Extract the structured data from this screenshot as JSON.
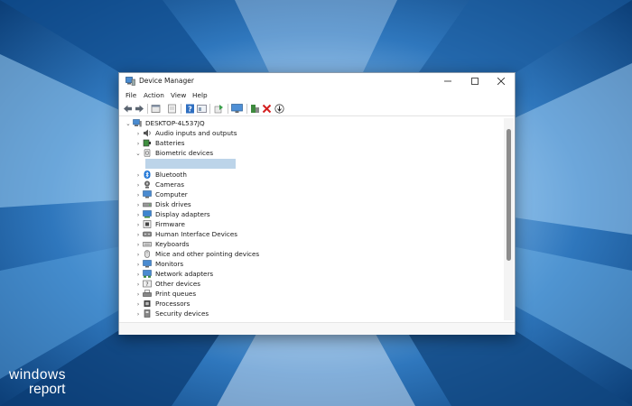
{
  "window": {
    "title": "Device Manager",
    "controls": {
      "minimize": "minimize",
      "maximize": "maximize",
      "close": "close"
    }
  },
  "menu": [
    "File",
    "Action",
    "View",
    "Help"
  ],
  "toolbar": {
    "icons": [
      "back-icon",
      "forward-icon",
      "properties-icon",
      "show-hidden-icon",
      "help-icon",
      "console-icon",
      "update-driver-icon",
      "scan-hardware-icon",
      "add-device-icon",
      "uninstall-icon",
      "disable-icon"
    ]
  },
  "tree": {
    "root": "DESKTOP-4L537JQ",
    "items": [
      {
        "label": "Audio inputs and outputs",
        "icon": "speaker-icon"
      },
      {
        "label": "Batteries",
        "icon": "battery-icon"
      },
      {
        "label": "Biometric devices",
        "icon": "biometric-icon",
        "expanded": true
      },
      {
        "label": "Bluetooth",
        "icon": "bluetooth-icon"
      },
      {
        "label": "Cameras",
        "icon": "camera-icon"
      },
      {
        "label": "Computer",
        "icon": "computer-icon"
      },
      {
        "label": "Disk drives",
        "icon": "disk-icon"
      },
      {
        "label": "Display adapters",
        "icon": "display-icon"
      },
      {
        "label": "Firmware",
        "icon": "firmware-icon"
      },
      {
        "label": "Human Interface Devices",
        "icon": "hid-icon"
      },
      {
        "label": "Keyboards",
        "icon": "keyboard-icon"
      },
      {
        "label": "Mice and other pointing devices",
        "icon": "mouse-icon"
      },
      {
        "label": "Monitors",
        "icon": "monitor-icon"
      },
      {
        "label": "Network adapters",
        "icon": "network-icon"
      },
      {
        "label": "Other devices",
        "icon": "other-device-icon"
      },
      {
        "label": "Print queues",
        "icon": "printer-icon"
      },
      {
        "label": "Processors",
        "icon": "processor-icon"
      },
      {
        "label": "Security devices",
        "icon": "security-icon"
      }
    ]
  },
  "brand": {
    "line1": "windows",
    "line2": "report"
  },
  "colors": {
    "accent": "#1a73d6",
    "selection": "#bcd4e9",
    "desktop": "#2a6aa8"
  }
}
